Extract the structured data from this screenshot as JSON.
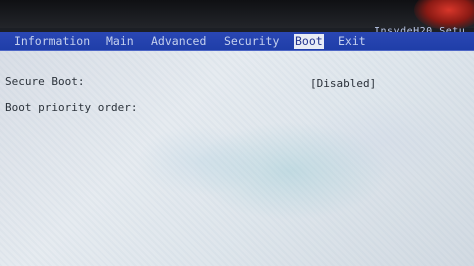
{
  "bios_title": "InsydeH20 Setu",
  "menu": {
    "items": [
      {
        "label": "Information",
        "active": false
      },
      {
        "label": "Main",
        "active": false
      },
      {
        "label": "Advanced",
        "active": false
      },
      {
        "label": "Security",
        "active": false
      },
      {
        "label": "Boot",
        "active": true
      },
      {
        "label": "Exit",
        "active": false
      }
    ]
  },
  "boot_page": {
    "secure_boot": {
      "label": "Secure Boot:",
      "value": "[Disabled]"
    },
    "boot_priority": {
      "label": "Boot priority order:"
    }
  },
  "colors": {
    "menubar": "#1f3ea8",
    "menu_text": "#c4d0ee",
    "active_tab_bg": "#e8ecf6",
    "active_tab_text": "#24358f",
    "content_bg": "#e0e6ec"
  }
}
